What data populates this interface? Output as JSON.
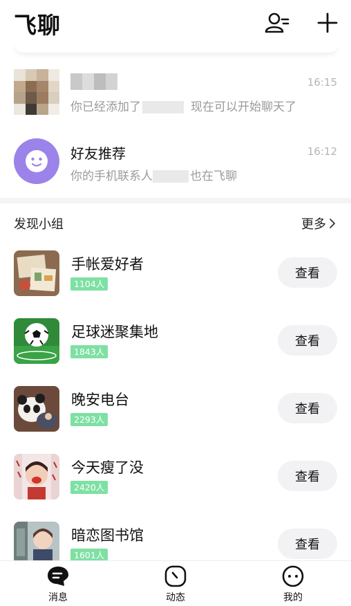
{
  "header": {
    "title": "飞聊",
    "contacts_icon": "contacts-icon",
    "add_icon": "plus-icon"
  },
  "chats": [
    {
      "name": "",
      "time": "16:15",
      "preview_before": "你已经添加了",
      "preview_after": "现在可以开始聊天了",
      "avatar": "pixelated-avatar"
    },
    {
      "name": "好友推荐",
      "time": "16:12",
      "preview_before": "你的手机联系人",
      "preview_after": "也在飞聊",
      "avatar": "smile-icon"
    }
  ],
  "discover": {
    "title": "发现小组",
    "more_label": "更多",
    "groups": [
      {
        "name": "手帐爱好者",
        "members": "1104人",
        "action": "查看"
      },
      {
        "name": "足球迷聚集地",
        "members": "1843人",
        "action": "查看"
      },
      {
        "name": "晚安电台",
        "members": "2293人",
        "action": "查看"
      },
      {
        "name": "今天瘦了没",
        "members": "2420人",
        "action": "查看"
      },
      {
        "name": "暗恋图书馆",
        "members": "1601人",
        "action": "查看"
      }
    ]
  },
  "tabs": [
    {
      "label": "消息",
      "icon": "message-icon"
    },
    {
      "label": "动态",
      "icon": "clock-icon"
    },
    {
      "label": "我的",
      "icon": "profile-face-icon"
    }
  ],
  "colors": {
    "accent_purple": "#9b83ea",
    "badge_green": "#7ee0a3",
    "button_bg": "#f2f2f4"
  }
}
